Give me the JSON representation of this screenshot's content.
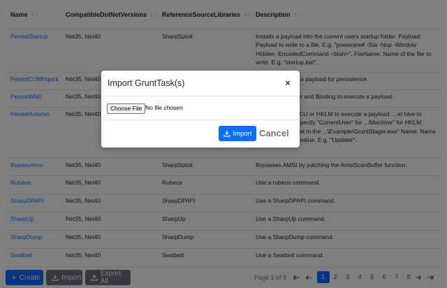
{
  "table": {
    "headers": [
      "Name",
      "CompatibleDotNetVersions",
      "ReferenceSourceLibraries",
      "Description"
    ],
    "sort_glyph": "↑↓",
    "rows": [
      {
        "name": "PersistStartup",
        "versions": "Net35, Net40",
        "lib": "SharpSploit",
        "desc": "Installs a payload into the current users startup folder. Payload: Payload to write to a file. E.g. \"powershell -Sta -Nop -Window Hidden -EncodedCommand <blah>\". FileName: Name of the file to write. E.g. \"startup.bat\"."
      },
      {
        "name": "PersistCOMHijack",
        "versions": "Net35, Net40",
        "lib": "",
        "desc": "...key to execute a payload for persistence."
      },
      {
        "name": "PersistWMI",
        "versions": "Net35, Net40",
        "lib": "",
        "desc": "...vent, Consumer and Binding to execute a payload."
      },
      {
        "name": "PersistAutorun",
        "versions": "Net35, Net40",
        "lib": "",
        "desc": "...un value in HKCU or HKLM to execute a payload. ...et hive to install autorun. Specify \"CurrentUser\" for ...lMachine\" for HKLM. Value: Value to set in the ...\\Example\\GruntStager.exe\" Name: Name for the ...registry value. E.g. \"Updater\"."
      },
      {
        "name": "BypassAmsi",
        "versions": "Net35, Net40",
        "lib": "SharpSploit",
        "desc": "Bypasses AMSI by patching the AmsiScanBuffer function."
      },
      {
        "name": "Rubeus",
        "versions": "Net35, Net40",
        "lib": "Rubeus",
        "desc": "Use a rubeus command."
      },
      {
        "name": "SharpDPAPI",
        "versions": "Net35, Net40",
        "lib": "SharpDPAPI",
        "desc": "Use a SharpDPAPI command."
      },
      {
        "name": "SharpUp",
        "versions": "Net35, Net40",
        "lib": "SharpUp",
        "desc": "Use a SharpUp command."
      },
      {
        "name": "SharpDump",
        "versions": "Net35, Net40",
        "lib": "SharpDump",
        "desc": "Use a SharpDump command."
      },
      {
        "name": "Seatbelt",
        "versions": "Net35, Net40",
        "lib": "Seatbelt",
        "desc": "Use a Seatbelt command."
      }
    ]
  },
  "footer": {
    "create_label": "Create",
    "import_label": "Import",
    "export_label": "Export All",
    "page_label": "Page 1 of 9",
    "pages": [
      "1",
      "2",
      "3",
      "4",
      "5",
      "6",
      "7",
      "8"
    ],
    "active_page": "1"
  },
  "modal": {
    "title": "Import GruntTask(s)",
    "close": "×",
    "choose_file": "Choose File",
    "no_file": "No file chosen",
    "import_label": "Import",
    "cancel_label": "Cancel"
  },
  "colors": {
    "primary": "#0d6efd",
    "secondary": "#6c757d",
    "overlay": "rgba(0,0,0,0.5)"
  }
}
